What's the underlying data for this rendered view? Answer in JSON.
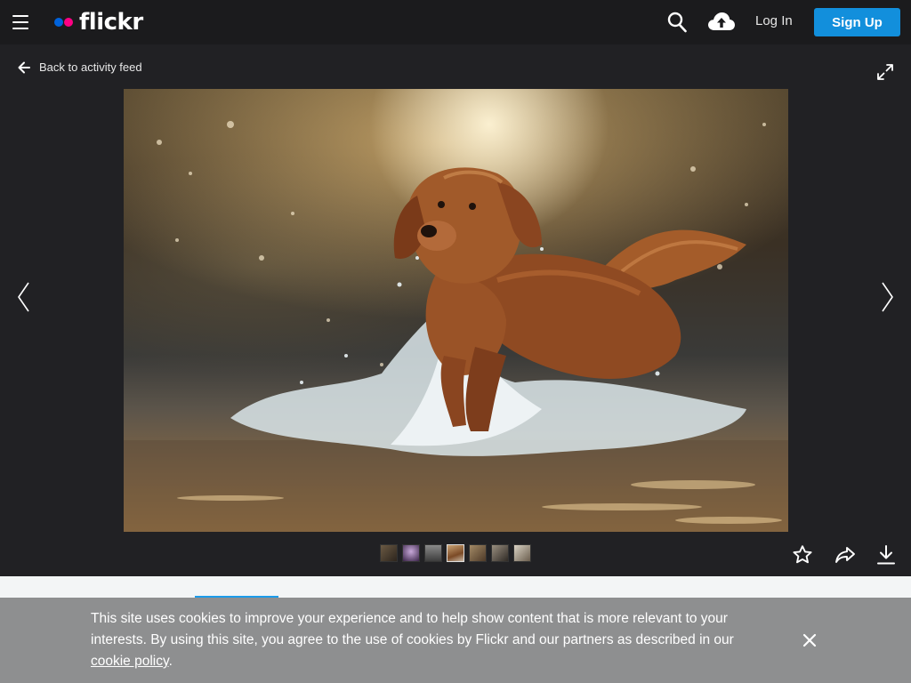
{
  "header": {
    "logo_text": "flickr",
    "login_label": "Log In",
    "signup_label": "Sign Up",
    "icons": [
      "menu-icon",
      "search-icon",
      "upload-cloud-icon"
    ]
  },
  "viewer": {
    "back_label": "Back to activity feed",
    "thumbnail_count": 7,
    "active_thumbnail_index": 3,
    "actions": [
      "favorite-star-icon",
      "share-arrow-icon",
      "download-icon"
    ]
  },
  "cookie_banner": {
    "text": "This site uses cookies to improve your experience and to help show content that is more relevant to your interests. By using this site, you agree to the use of cookies by Flickr and our partners as described in our ",
    "link_text": "cookie policy",
    "trailing": "."
  },
  "colors": {
    "topbar_bg": "#1b1b1d",
    "page_bg": "#212124",
    "brand_blue": "#0063dc",
    "brand_pink": "#ff0084",
    "signup_bg": "#128fdc",
    "cookie_bg": "#8e8f90"
  }
}
